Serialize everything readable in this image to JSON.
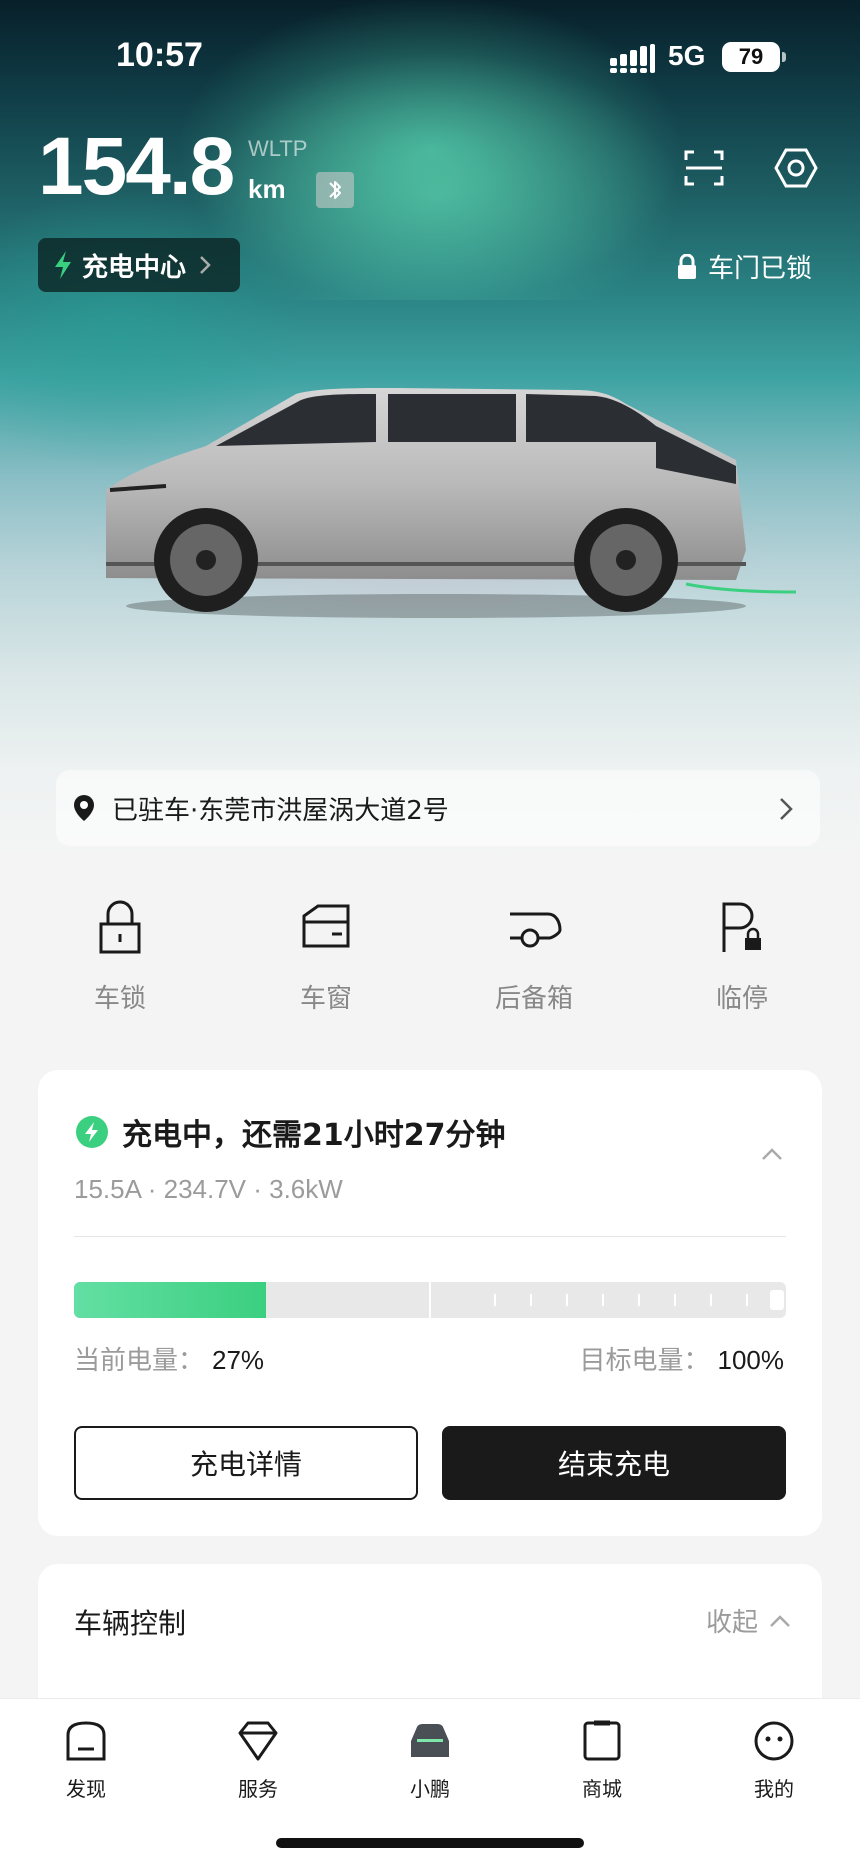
{
  "status_bar": {
    "time": "10:57",
    "network": "5G",
    "battery": "79"
  },
  "vehicle": {
    "range_value": "154.8",
    "range_standard": "WLTP",
    "range_unit": "km",
    "charge_center_label": "充电中心",
    "door_status": "车门已锁"
  },
  "location": {
    "text": "已驻车·东莞市洪屋涡大道2号"
  },
  "quick_actions": [
    {
      "label": "车锁",
      "icon": "lock-icon"
    },
    {
      "label": "车窗",
      "icon": "window-icon"
    },
    {
      "label": "后备箱",
      "icon": "trunk-icon"
    },
    {
      "label": "临停",
      "icon": "parking-icon"
    }
  ],
  "charging": {
    "title": "充电中，还需21小时27分钟",
    "details": "15.5A · 234.7V · 3.6kW",
    "current_level_label": "当前电量：",
    "current_level_value": "27%",
    "target_level_label": "目标电量：",
    "target_level_value": "100%",
    "current_fraction": 0.27,
    "target_fraction": 1.0,
    "details_button": "充电详情",
    "stop_button": "结束充电",
    "accent_color": "#3bcf80"
  },
  "vehicle_control": {
    "title": "车辆控制",
    "collapse_label": "收起"
  },
  "tab_bar": [
    {
      "label": "发现",
      "icon": "discover-icon"
    },
    {
      "label": "服务",
      "icon": "service-icon"
    },
    {
      "label": "小鹏",
      "icon": "car-icon",
      "active": true
    },
    {
      "label": "商城",
      "icon": "mall-icon"
    },
    {
      "label": "我的",
      "icon": "profile-icon"
    }
  ]
}
